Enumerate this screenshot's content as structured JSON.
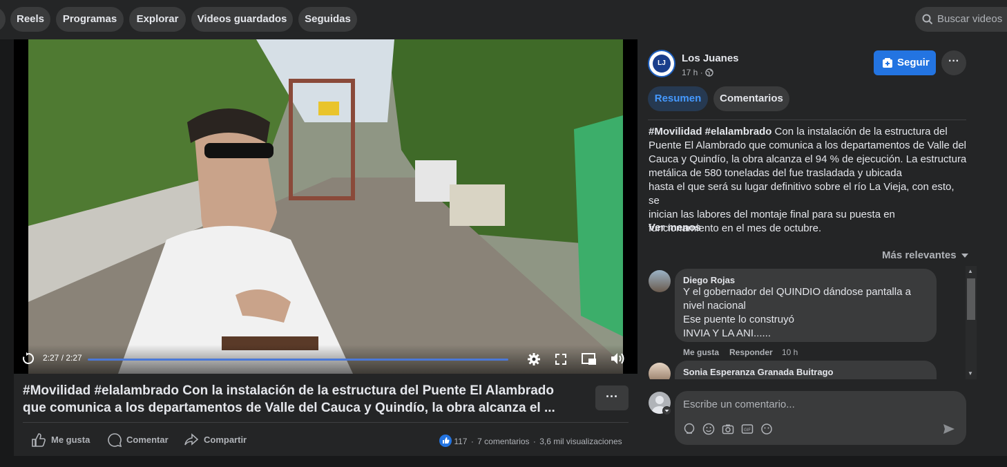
{
  "topbar": {
    "chips": [
      "Reels",
      "Programas",
      "Explorar",
      "Videos guardados",
      "Seguidas"
    ],
    "search_placeholder": "Buscar videos"
  },
  "video": {
    "time": "2:27 / 2:27",
    "progress": 1.0
  },
  "post": {
    "title_line1": "#Movilidad #elalambrado Con la instalación de la estructura del Puente El Alambrado",
    "title_line2": "que comunica a los departamentos de Valle del Cauca y Quindío, la obra alcanza el ...",
    "more": "···",
    "actions": {
      "like": "Me gusta",
      "comment": "Comentar",
      "share": "Compartir"
    },
    "stats": {
      "reactions": "117",
      "comments": "7 comentarios",
      "views": "3,6 mil visualizaciones",
      "sep": "·"
    }
  },
  "page": {
    "name": "Los Juanes",
    "time": "17 h ·",
    "avatar_text": "LJ",
    "follow": "Seguir",
    "more": "···"
  },
  "tabs": {
    "summary": "Resumen",
    "comments": "Comentarios"
  },
  "description": {
    "tags": "#Movilidad #elalambrado",
    "line1_rest": " Con la instalación de la estructura del",
    "line2": "Puente El Alambrado que comunica a los departamentos de Valle del",
    "line3": "Cauca y Quindío, la obra alcanza el 94 % de ejecución. La estructura",
    "line4": "metálica de 580 toneladas del fue trasladada y ubicada",
    "line5": "hasta el que será su lugar definitivo sobre el río La Vieja, con esto, se",
    "line6": "inician las labores del montaje final para su puesta en",
    "line7": "funcionamiento en el mes de octubre.",
    "see_less": "Ver menos"
  },
  "sort_label": "Más relevantes",
  "comments": [
    {
      "author": "Diego Rojas",
      "lines": [
        "Y el gobernador del QUINDIO dándose pantalla a",
        "nivel nacional",
        "Ese puente lo construyó",
        "INVIA Y LA ANI......"
      ],
      "like": "Me gusta",
      "reply": "Responder",
      "time": "10 h"
    },
    {
      "author": "Sonia Esperanza Granada Buitrago"
    }
  ],
  "composer": {
    "placeholder": "Escribe un comentario..."
  },
  "colors": {
    "accent": "#2374e1",
    "bg": "#242526",
    "surface": "#3a3b3c"
  }
}
